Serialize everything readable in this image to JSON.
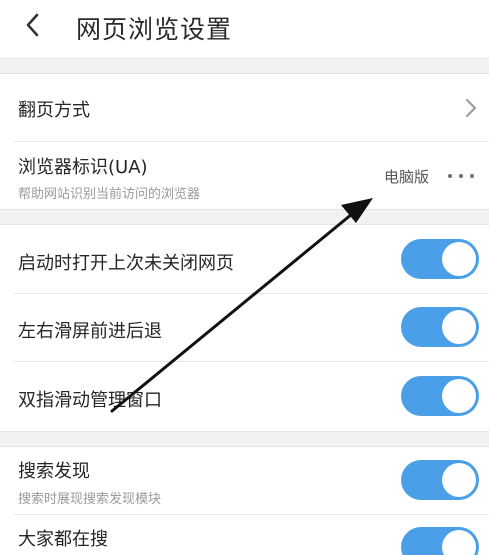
{
  "header": {
    "title": "网页浏览设置",
    "back_icon": "chevron-left-icon"
  },
  "settings": {
    "page_turn": {
      "label": "翻页方式",
      "icon": "chevron-right-icon"
    },
    "user_agent": {
      "label": "浏览器标识(UA)",
      "description": "帮助网站识别当前访问的浏览器",
      "value": "电脑版",
      "icon": "more-dots-icon"
    },
    "reopen_last": {
      "label": "启动时打开上次未关闭网页",
      "enabled": true
    },
    "swipe_nav": {
      "label": "左右滑屏前进后退",
      "enabled": true
    },
    "two_finger": {
      "label": "双指滑动管理窗口",
      "enabled": true
    },
    "search_discover": {
      "label": "搜索发现",
      "description": "搜索时展现搜索发现模块",
      "enabled": true
    },
    "trending": {
      "label": "大家都在搜",
      "enabled": true
    }
  },
  "colors": {
    "toggle_on": "#4a9fe8",
    "section_gap": "#f2f2f2",
    "annotation_arrow": "#111111"
  }
}
